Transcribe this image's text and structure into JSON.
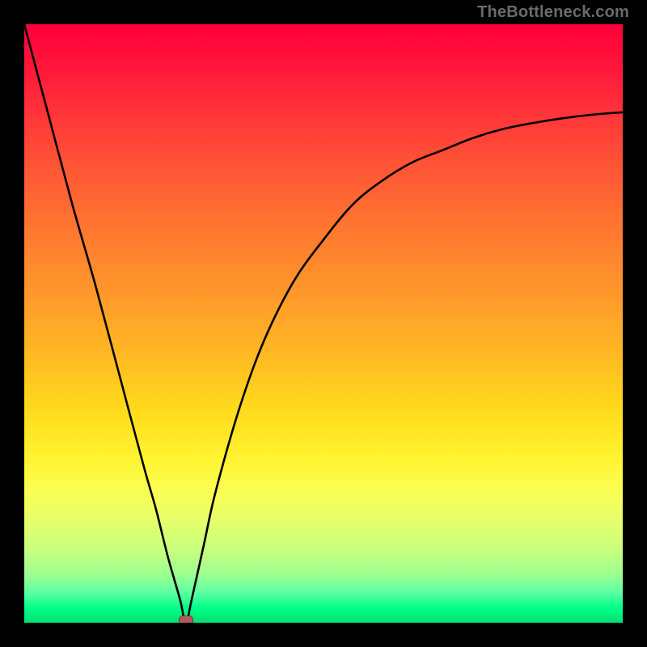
{
  "watermark": {
    "text": "TheBottleneck.com"
  },
  "chart_data": {
    "type": "line",
    "title": "",
    "xlabel": "",
    "ylabel": "",
    "xlim": [
      0,
      100
    ],
    "ylim": [
      0,
      100
    ],
    "grid": false,
    "legend": false,
    "background": {
      "kind": "vertical-gradient",
      "stops": [
        {
          "pos": 0,
          "color": "#ff003a"
        },
        {
          "pos": 50,
          "color": "#ffc020"
        },
        {
          "pos": 78,
          "color": "#fbff52"
        },
        {
          "pos": 100,
          "color": "#00e072"
        }
      ]
    },
    "series": [
      {
        "name": "bottleneck-curve",
        "stroke": "#000000",
        "x": [
          0,
          4,
          8,
          12,
          16,
          20,
          22,
          24,
          26,
          27,
          28,
          30,
          32,
          36,
          40,
          45,
          50,
          55,
          60,
          65,
          70,
          75,
          80,
          85,
          90,
          95,
          100
        ],
        "y": [
          100,
          85,
          70,
          56,
          41,
          26,
          19,
          11,
          4,
          0,
          4,
          13,
          22,
          36,
          47,
          57,
          64,
          70,
          74,
          77,
          79,
          81,
          82.5,
          83.5,
          84.3,
          84.9,
          85.3
        ]
      }
    ],
    "annotations": [
      {
        "kind": "min-marker",
        "x": 27,
        "y": 0,
        "color": "#b05a5a"
      }
    ]
  }
}
